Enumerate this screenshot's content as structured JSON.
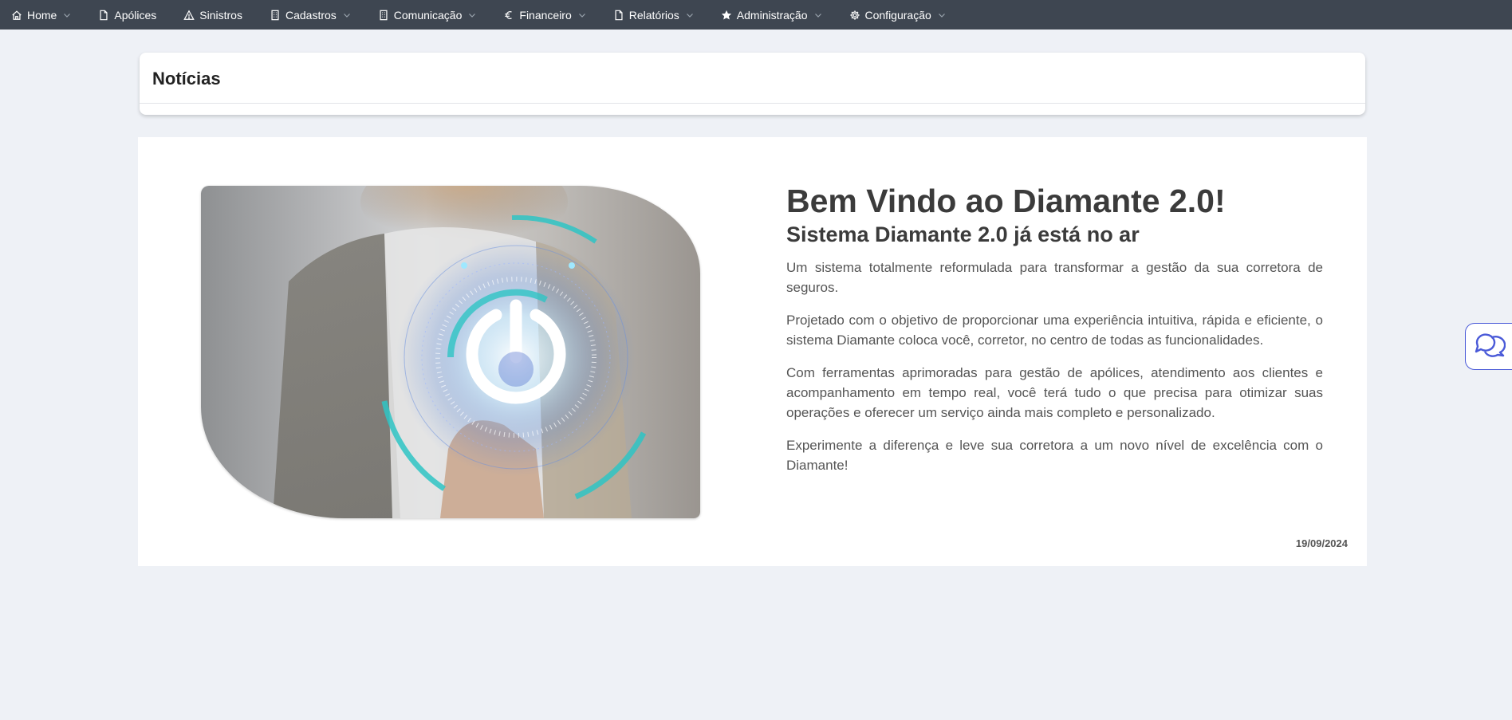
{
  "nav": {
    "items": [
      {
        "label": "Home",
        "icon": "home-icon",
        "dropdown": true
      },
      {
        "label": "Apólices",
        "icon": "document-icon",
        "dropdown": false
      },
      {
        "label": "Sinistros",
        "icon": "warning-icon",
        "dropdown": false
      },
      {
        "label": "Cadastros",
        "icon": "building-icon",
        "dropdown": true
      },
      {
        "label": "Comunicação",
        "icon": "building-icon",
        "dropdown": true
      },
      {
        "label": "Financeiro",
        "icon": "euro-icon",
        "dropdown": true
      },
      {
        "label": "Relatórios",
        "icon": "document-icon",
        "dropdown": true
      },
      {
        "label": "Administração",
        "icon": "star-icon",
        "dropdown": true
      },
      {
        "label": "Configuração",
        "icon": "gear-icon",
        "dropdown": true
      }
    ]
  },
  "news": {
    "title": "Notícias"
  },
  "article": {
    "headline": "Bem Vindo ao Diamante 2.0!",
    "subheadline": "Sistema Diamante 2.0 já está no ar",
    "paragraphs": [
      "Um sistema totalmente reformulada para transformar a gestão da sua corretora de seguros.",
      "Projetado com o objetivo de proporcionar uma experiência intuitiva, rápida e eficiente, o sistema Diamante coloca você, corretor, no centro de todas as funcionalidades.",
      "Com ferramentas aprimoradas para gestão de apólices, atendimento aos clientes e acompanhamento em tempo real, você terá tudo o que precisa para otimizar suas operações e oferecer um serviço ainda mais completo e personalizado.",
      "Experimente a diferença e leve sua corretora a um novo nível de excelência com o Diamante!"
    ],
    "date": "19/09/2024",
    "image": "power-button-hero-image"
  },
  "chat": {
    "icon": "chat-bubbles-icon"
  },
  "colors": {
    "navbar": "#3e4651",
    "page_bg": "#eef1f6",
    "chat_accent": "#4a5ad8",
    "power_glow": "#2ec4c4"
  }
}
